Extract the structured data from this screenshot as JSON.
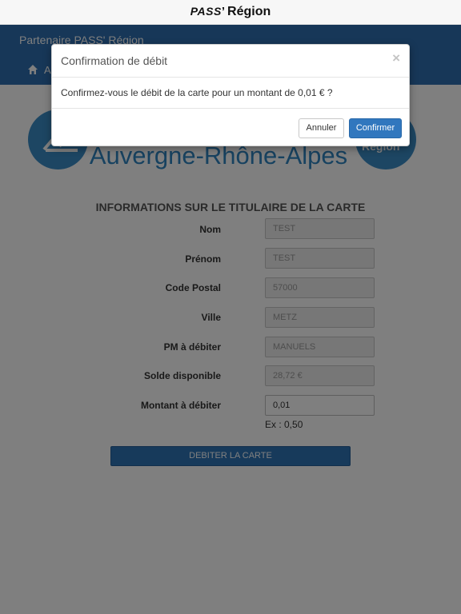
{
  "statusbar": {
    "brand_pass": "PASS",
    "brand_quote": "’",
    "brand_region": "Région"
  },
  "header": {
    "title": "Partenaire PASS' Région",
    "nav_text": "A"
  },
  "logos": {
    "right_text": "Région",
    "region_name": "Auvergne-Rhône-Alpes"
  },
  "form": {
    "section_title": "INFORMATIONS SUR LE TITULAIRE DE LA CARTE",
    "fields": [
      {
        "label": "Nom",
        "value": "TEST"
      },
      {
        "label": "Prénom",
        "value": "TEST"
      },
      {
        "label": "Code Postal",
        "value": "57000"
      },
      {
        "label": "Ville",
        "value": "METZ"
      },
      {
        "label": "PM à débiter",
        "value": "MANUELS"
      },
      {
        "label": "Solde disponible",
        "value": "28,72 €"
      },
      {
        "label": "Montant à débiter",
        "value": "0,01"
      }
    ],
    "amount_hint": "Ex : 0,50",
    "submit_label": "DEBITER LA CARTE"
  },
  "modal": {
    "title": "Confirmation de débit",
    "close_symbol": "×",
    "message": "Confirmez-vous le débit de la carte pour un montant de 0,01 € ?",
    "cancel_label": "Annuler",
    "confirm_label": "Confirmer"
  },
  "colors": {
    "header_blue": "#2f6fb0",
    "button_blue": "#3177be",
    "logo_blue": "#3a8cc6",
    "region_text_blue": "#2f84c1"
  }
}
